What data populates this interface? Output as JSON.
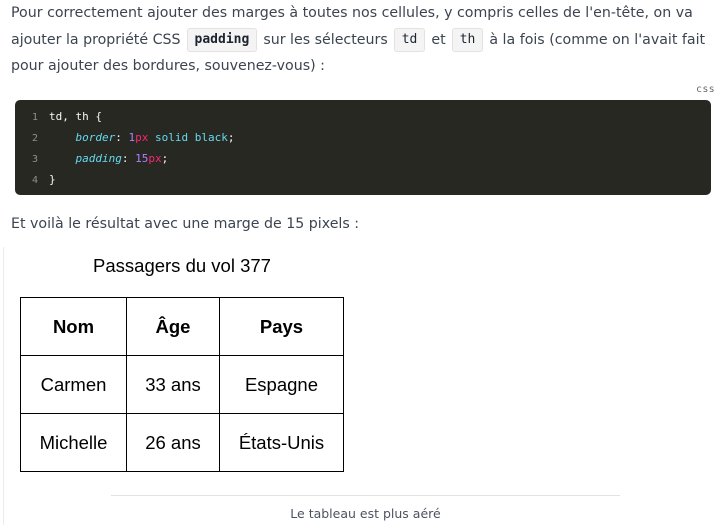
{
  "intro": {
    "text_1": "Pour correctement ajouter des marges à toutes nos cellules, y compris celles de l'en-tête, on va ajouter la propriété CSS",
    "code_padding": "padding",
    "text_2": "sur les sélecteurs",
    "code_td": "td",
    "text_3": "et",
    "code_th": "th",
    "text_4": "à la fois (comme on l'avait fait pour ajouter des bordures, souvenez-vous) :"
  },
  "code_block": {
    "language": "css",
    "lines": [
      {
        "num": "1",
        "selector": "td, th {"
      },
      {
        "num": "2",
        "prop": "border",
        "num_val": "1",
        "unit": "px",
        "rest": " solid black",
        "end": ";"
      },
      {
        "num": "3",
        "prop": "padding",
        "num_val": "15",
        "unit": "px",
        "end": ";"
      },
      {
        "num": "4",
        "close": "}"
      }
    ],
    "colon": ": "
  },
  "result_text": "Et voilà le résultat avec une marge de 15 pixels :",
  "figure": {
    "title": "Passagers du vol 377",
    "headers": [
      "Nom",
      "Âge",
      "Pays"
    ],
    "rows": [
      [
        "Carmen",
        "33 ans",
        "Espagne"
      ],
      [
        "Michelle",
        "26 ans",
        "États-Unis"
      ]
    ],
    "caption": "Le tableau est plus aéré"
  }
}
